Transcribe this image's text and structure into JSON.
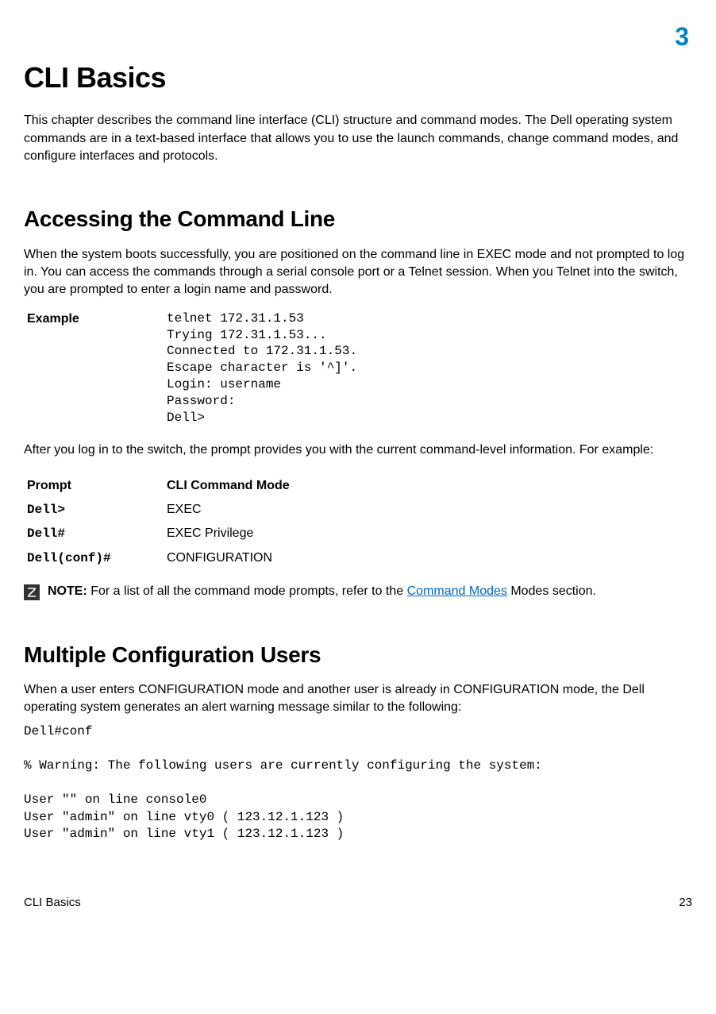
{
  "chapter_number": "3",
  "title": "CLI Basics",
  "intro": "This chapter describes the command line interface (CLI) structure and command modes. The Dell operating system commands are in a text-based interface that allows you to use the launch commands, change command modes, and configure interfaces and protocols.",
  "section1": {
    "heading": "Accessing the Command Line",
    "para1": "When the system boots successfully, you are positioned on the command line in EXEC mode and not prompted to log in. You can access the commands through a serial console port or a Telnet session. When you Telnet into the switch, you are prompted to enter a login name and password.",
    "example_label": "Example",
    "example_code": "telnet 172.31.1.53\nTrying 172.31.1.53...\nConnected to 172.31.1.53.\nEscape character is '^]'.\nLogin: username\nPassword:\nDell>",
    "para2": "After you log in to the switch, the prompt provides you with the current command-level information. For example:",
    "table": {
      "headers": {
        "col1": "Prompt",
        "col2": "CLI Command Mode"
      },
      "rows": [
        {
          "prompt": "Dell>",
          "mode": "EXEC"
        },
        {
          "prompt": "Dell#",
          "mode": "EXEC Privilege"
        },
        {
          "prompt": "Dell(conf)#",
          "mode": "CONFIGURATION"
        }
      ]
    },
    "note": {
      "label": "NOTE:",
      "before_link": " For a list of all the command mode prompts, refer to the ",
      "link_text": "Command Modes",
      "after_link": " Modes section."
    }
  },
  "section2": {
    "heading": "Multiple Configuration Users",
    "para1": "When a user enters CONFIGURATION mode and another user is already in CONFIGURATION mode, the Dell operating system generates an alert warning message similar to the following:",
    "code": "Dell#conf\n\n% Warning: The following users are currently configuring the system:\n\nUser \"\" on line console0\nUser \"admin\" on line vty0 ( 123.12.1.123 )\nUser \"admin\" on line vty1 ( 123.12.1.123 )"
  },
  "footer": {
    "left": "CLI Basics",
    "right": "23"
  }
}
